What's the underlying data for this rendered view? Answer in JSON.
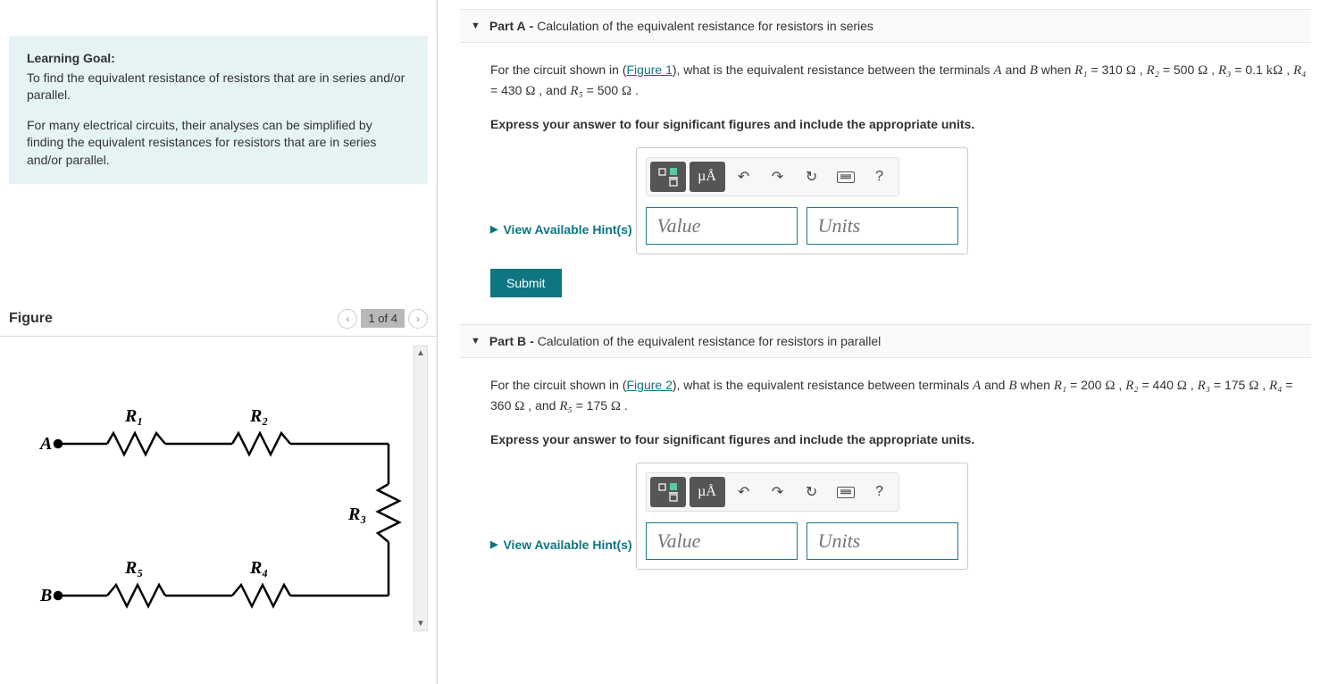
{
  "learning": {
    "title": "Learning Goal:",
    "para1": "To find the equivalent resistance of resistors that are in series and/or parallel.",
    "para2": "For many electrical circuits, their analyses can be simplified by finding the equivalent resistances for resistors that are in series and/or parallel."
  },
  "figure": {
    "heading": "Figure",
    "pager": "1 of 4",
    "terminals": {
      "A": "A",
      "B": "B"
    },
    "resistors": {
      "R1": "R₁",
      "R2": "R₂",
      "R3": "R₃",
      "R4": "R₄",
      "R5": "R₅"
    }
  },
  "partA": {
    "label": "Part A",
    "dash": " - ",
    "title": "Calculation of the equivalent resistance for resistors in series",
    "text_prefix": "For the circuit shown in (",
    "figure_link": "Figure 1",
    "text_mid1": "), what is the equivalent resistance between the terminals ",
    "termA": "A",
    "and_str": " and ",
    "termB": "B",
    "when_str": " when ",
    "R1": "R₁",
    "eq1": " = 310 ",
    "ohm": "Ω",
    "c1": " , ",
    "R2": "R₂",
    "eq2": " = 500 ",
    "c2": " , ",
    "R3": "R₃",
    "eq3": " = 0.1 ",
    "kohm": "kΩ",
    "c3": " , ",
    "R4": "R₄",
    "eq4": " = 430 ",
    "c4": " , and ",
    "R5": "R₅",
    "eq5": " = 500 ",
    "period": " .",
    "instruct": "Express your answer to four significant figures and include the appropriate units.",
    "hints": "View Available Hint(s)",
    "muA": "µÅ",
    "qmark": "?",
    "value_ph": "Value",
    "units_ph": "Units",
    "submit": "Submit"
  },
  "partB": {
    "label": "Part B",
    "dash": " - ",
    "title": "Calculation of the equivalent resistance for resistors in parallel",
    "text_prefix": "For the circuit shown in (",
    "figure_link": "Figure 2",
    "text_mid1": "), what is the equivalent resistance between terminals ",
    "termA": "A",
    "and_str": " and ",
    "termB": "B",
    "when_str": " when ",
    "R1": "R₁",
    "eq1": " = 200 ",
    "ohm": "Ω",
    "c1": " , ",
    "R2": "R₂",
    "eq2": " = 440 ",
    "c2": " , ",
    "R3": "R₃",
    "eq3": " = 175 ",
    "c3": " , ",
    "R4": "R₄",
    "eq4": " = 360 ",
    "c4": " , and ",
    "R5": "R₅",
    "eq5": " = 175 ",
    "period": " .",
    "instruct": "Express your answer to four significant figures and include the appropriate units.",
    "hints": "View Available Hint(s)",
    "muA": "µÅ",
    "qmark": "?",
    "value_ph": "Value",
    "units_ph": "Units"
  }
}
